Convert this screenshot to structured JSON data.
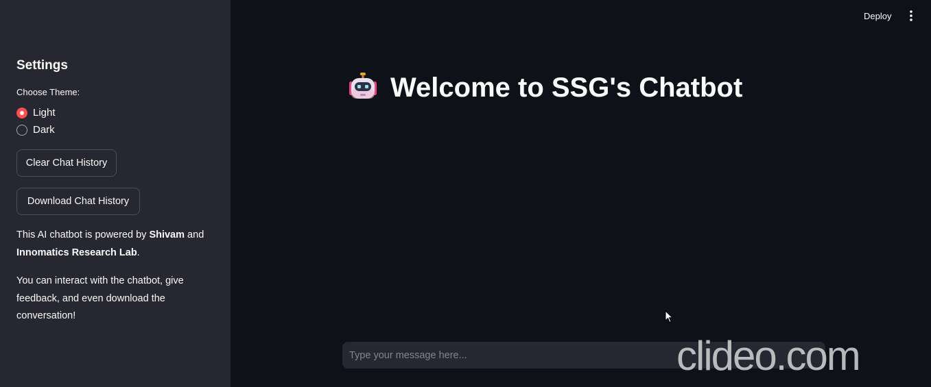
{
  "sidebar": {
    "title": "Settings",
    "theme_label": "Choose Theme:",
    "theme_options": [
      {
        "label": "Light",
        "selected": true
      },
      {
        "label": "Dark",
        "selected": false
      }
    ],
    "clear_button": "Clear Chat History",
    "download_button": "Download Chat History",
    "about": {
      "prefix": "This AI chatbot is powered by ",
      "name1": "Shivam",
      "middle": " and ",
      "name2": "Innomatics Research Lab",
      "suffix": "."
    },
    "info": "You can interact with the chatbot, give feedback, and even download the conversation!"
  },
  "header": {
    "deploy_label": "Deploy",
    "menu_icon": "more-vertical-icon"
  },
  "main": {
    "title_icon": "robot-icon",
    "title": "Welcome to SSG's Chatbot",
    "chat_placeholder": "Type your message here..."
  },
  "watermark": "clideo.com",
  "colors": {
    "background": "#0e1117",
    "sidebar": "#262730",
    "accent": "#ff4b4b",
    "text": "#fafafa"
  }
}
